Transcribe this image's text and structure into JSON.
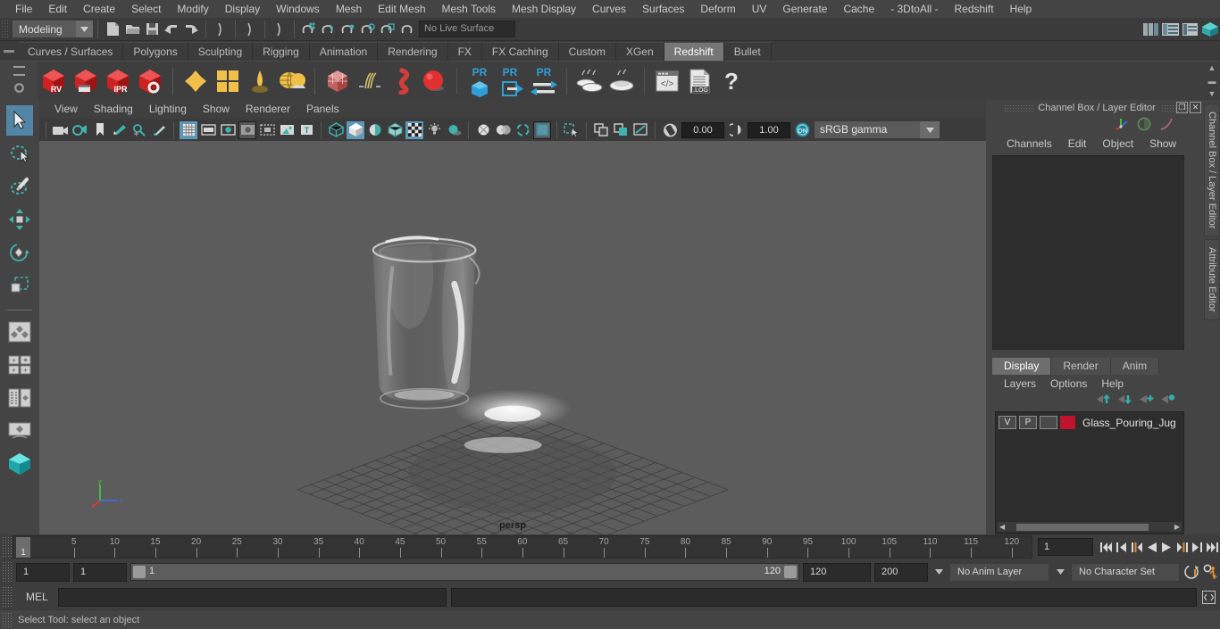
{
  "app": {
    "title": "Autodesk Maya",
    "accent": "#5285a6",
    "panel_bg": "#444444",
    "viewport_bg": "#5c5c5c"
  },
  "menubar": {
    "items": [
      "File",
      "Edit",
      "Create",
      "Select",
      "Modify",
      "Display",
      "Windows",
      "Mesh",
      "Edit Mesh",
      "Mesh Tools",
      "Mesh Display",
      "Curves",
      "Surfaces",
      "Deform",
      "UV",
      "Generate",
      "Cache",
      "- 3DtoAll -",
      "Redshift",
      "Help"
    ]
  },
  "statusline": {
    "menuset_value": "Modeling",
    "live_surface_value": "No Live Surface",
    "icons": [
      "new-scene-icon",
      "open-scene-icon",
      "save-scene-icon",
      "undo-icon",
      "redo-icon",
      "select-hierarchy-icon",
      "select-object-icon",
      "select-component-icon",
      "snap-grid-icon",
      "snap-curve-icon",
      "snap-point-icon",
      "snap-projected-icon",
      "snap-view-plane-icon",
      "make-live-icon",
      "render-current-frame-icon",
      "ipr-render-icon",
      "render-settings-icon",
      "hypershade-icon",
      "render-view-icon",
      "toggle-sidebar-icon",
      "attribute-editor-icon",
      "tool-settings-icon",
      "channel-box-icon"
    ]
  },
  "shelf": {
    "tabs": [
      "Curves / Surfaces",
      "Polygons",
      "Sculpting",
      "Rigging",
      "Animation",
      "Rendering",
      "FX",
      "FX Caching",
      "Custom",
      "XGen",
      "Redshift",
      "Bullet"
    ],
    "active_tab": "Redshift",
    "buttons": [
      {
        "name": "redshift-render-view",
        "label": "RV"
      },
      {
        "name": "redshift-render-sequence",
        "label": ""
      },
      {
        "name": "redshift-ipr",
        "label": "IPR"
      },
      {
        "name": "redshift-render-settings",
        "label": ""
      },
      {
        "name": "redshift-material",
        "label": ""
      },
      {
        "name": "redshift-material-blender",
        "label": ""
      },
      {
        "name": "redshift-light-dome",
        "label": ""
      },
      {
        "name": "redshift-environment",
        "label": ""
      },
      {
        "name": "redshift-volume",
        "label": ""
      },
      {
        "name": "redshift-hair",
        "label": ""
      },
      {
        "name": "redshift-proxy-object",
        "label": ""
      },
      {
        "name": "redshift-sphere",
        "label": ""
      },
      {
        "name": "redshift-pr-object",
        "label": "PR"
      },
      {
        "name": "redshift-pr-export",
        "label": "PR"
      },
      {
        "name": "redshift-pr-exchange",
        "label": "PR"
      },
      {
        "name": "redshift-bake-multi",
        "label": ""
      },
      {
        "name": "redshift-bake-single",
        "label": ""
      },
      {
        "name": "redshift-script-editor",
        "label": ""
      },
      {
        "name": "redshift-log",
        "label": ".LOG"
      },
      {
        "name": "redshift-help",
        "label": "?"
      }
    ]
  },
  "toolbox": {
    "items": [
      {
        "name": "select-tool",
        "selected": true
      },
      {
        "name": "lasso-select-tool",
        "selected": false
      },
      {
        "name": "paint-select-tool",
        "selected": false
      },
      {
        "name": "move-tool",
        "selected": false
      },
      {
        "name": "rotate-tool",
        "selected": false
      },
      {
        "name": "scale-tool",
        "selected": false
      },
      {
        "name": "last-tool-used",
        "selected": false
      },
      {
        "name": "four-view-layout",
        "selected": false
      },
      {
        "name": "persp-outliner-layout",
        "selected": false
      },
      {
        "name": "single-perspective-layout",
        "selected": false
      },
      {
        "name": "maya-logo",
        "selected": false
      }
    ]
  },
  "viewport": {
    "menu": [
      "View",
      "Shading",
      "Lighting",
      "Show",
      "Renderer",
      "Panels"
    ],
    "camera_label": "persp",
    "exposure_value": "0.00",
    "gamma_value": "1.00",
    "color_management": "sRGB gamma",
    "toolbar_icons": [
      "camera-select-icon",
      "camera-attributes-icon",
      "bookmark-icon",
      "image-plane-icon",
      "two-d-pan-zoom-icon",
      "grease-pencil-icon",
      "grid-toggle-icon",
      "film-gate-icon",
      "resolution-gate-icon",
      "gate-mask-icon",
      "film-origin-icon",
      "xray-icon",
      "xray-joints-icon",
      "wireframe-icon",
      "smooth-shade-all-icon",
      "smooth-shade-flat-icon",
      "shaded-wireframe-icon",
      "textured-icon",
      "lights-icon",
      "shadows-icon",
      "screen-space-ao-icon",
      "motion-blur-icon",
      "multisample-icon",
      "depth-of-field-icon",
      "isolate-select-icon",
      "xray-selected-icon",
      "xray-active-components-icon",
      "exposure-icon",
      "gamma-icon",
      "color-management-icon"
    ]
  },
  "right_panel": {
    "title": "Channel Box / Layer Editor",
    "menu": [
      "Channels",
      "Edit",
      "Object",
      "Show"
    ],
    "vertical_tabs": [
      "Channel Box / Layer Editor",
      "Attribute Editor"
    ],
    "layer_tabs": [
      "Display",
      "Render",
      "Anim"
    ],
    "layer_tabs_active": "Display",
    "layer_menu": [
      "Layers",
      "Options",
      "Help"
    ],
    "layers": [
      {
        "visibility": "V",
        "playback": "P",
        "state": "",
        "color": "#c0142d",
        "name": "Glass_Pouring_Jug"
      }
    ]
  },
  "timeline": {
    "ticks": [
      5,
      10,
      15,
      20,
      25,
      30,
      35,
      40,
      45,
      50,
      55,
      60,
      65,
      70,
      75,
      80,
      85,
      90,
      95,
      100,
      105,
      110,
      115,
      120
    ],
    "current_frame": "1",
    "frame_field": "1",
    "playback_buttons": [
      "go-to-start-icon",
      "step-back-keyframe-icon",
      "step-back-frame-icon",
      "play-backwards-icon",
      "play-forwards-icon",
      "step-forward-frame-icon",
      "step-forward-keyframe-icon",
      "go-to-end-icon"
    ]
  },
  "range": {
    "start_field": "1",
    "playback_start_field": "1",
    "slider_left_label": "1",
    "slider_right_label": "120",
    "playback_end_field": "120",
    "end_field": "200",
    "anim_layer": "No Anim Layer",
    "character_set": "No Character Set",
    "auto_key_icon": "auto-keyframe-icon",
    "anim_prefs_icon": "animation-preferences-icon"
  },
  "command_line": {
    "label": "MEL",
    "input_value": "",
    "result_value": "",
    "script_editor_icon": "script-editor-icon"
  },
  "status_bar": {
    "message": "Select Tool: select an object"
  }
}
